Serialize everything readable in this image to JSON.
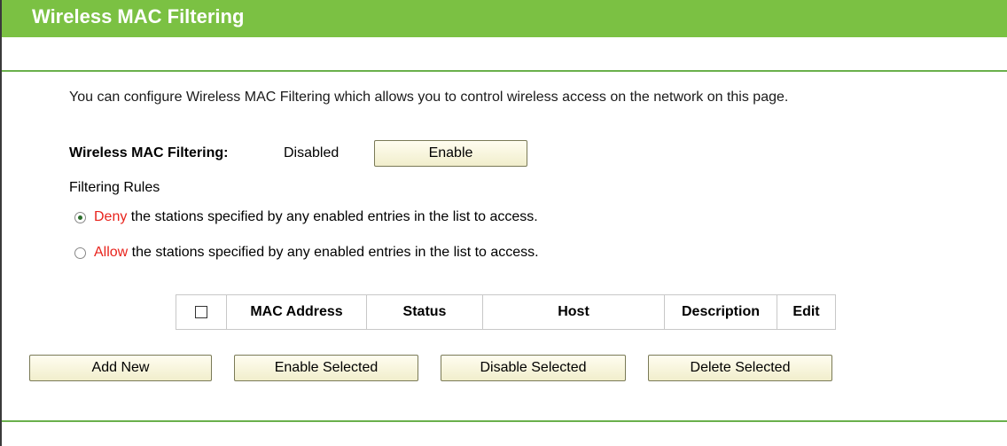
{
  "header": {
    "title": "Wireless MAC Filtering"
  },
  "intro": "You can configure Wireless MAC Filtering which allows you to control wireless access on the network on this page.",
  "filtering": {
    "label": "Wireless MAC Filtering:",
    "status": "Disabled",
    "enable_button": "Enable"
  },
  "rules": {
    "heading": "Filtering Rules",
    "options": [
      {
        "keyword": "Deny",
        "text": " the stations specified by any enabled entries in the list to access.",
        "selected": true
      },
      {
        "keyword": "Allow",
        "text": " the stations specified by any enabled entries in the list to access.",
        "selected": false
      }
    ]
  },
  "table": {
    "columns": [
      "MAC Address",
      "Status",
      "Host",
      "Description",
      "Edit"
    ]
  },
  "actions": {
    "add_new": "Add New",
    "enable_selected": "Enable Selected",
    "disable_selected": "Disable Selected",
    "delete_selected": "Delete Selected"
  },
  "colors": {
    "title_bar": "#7bc143",
    "rule_line": "#6ab04c",
    "keyword": "#e8231c"
  }
}
